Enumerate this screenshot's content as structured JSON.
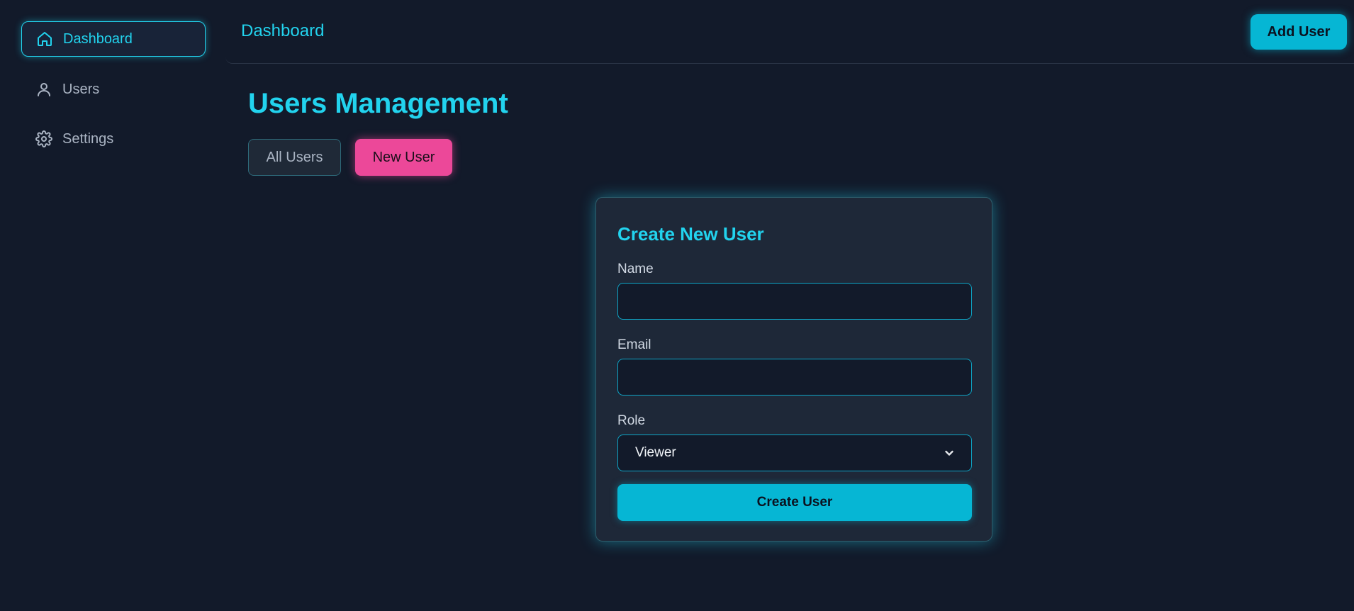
{
  "sidebar": {
    "items": [
      {
        "label": "Dashboard",
        "icon": "home-icon",
        "active": true
      },
      {
        "label": "Users",
        "icon": "user-icon",
        "active": false
      },
      {
        "label": "Settings",
        "icon": "gear-icon",
        "active": false
      }
    ]
  },
  "topbar": {
    "title": "Dashboard",
    "add_user_label": "Add User"
  },
  "main": {
    "page_title": "Users Management",
    "tabs": [
      {
        "label": "All Users",
        "active": false
      },
      {
        "label": "New User",
        "active": true
      }
    ]
  },
  "form": {
    "title": "Create New User",
    "name_label": "Name",
    "name_value": "",
    "email_label": "Email",
    "email_value": "",
    "role_label": "Role",
    "role_value": "Viewer",
    "submit_label": "Create User"
  },
  "colors": {
    "background": "#121a2a",
    "accent": "#22d3ee",
    "button_primary": "#06b6d4",
    "button_highlight": "#ec4899",
    "card": "#1e2838"
  }
}
